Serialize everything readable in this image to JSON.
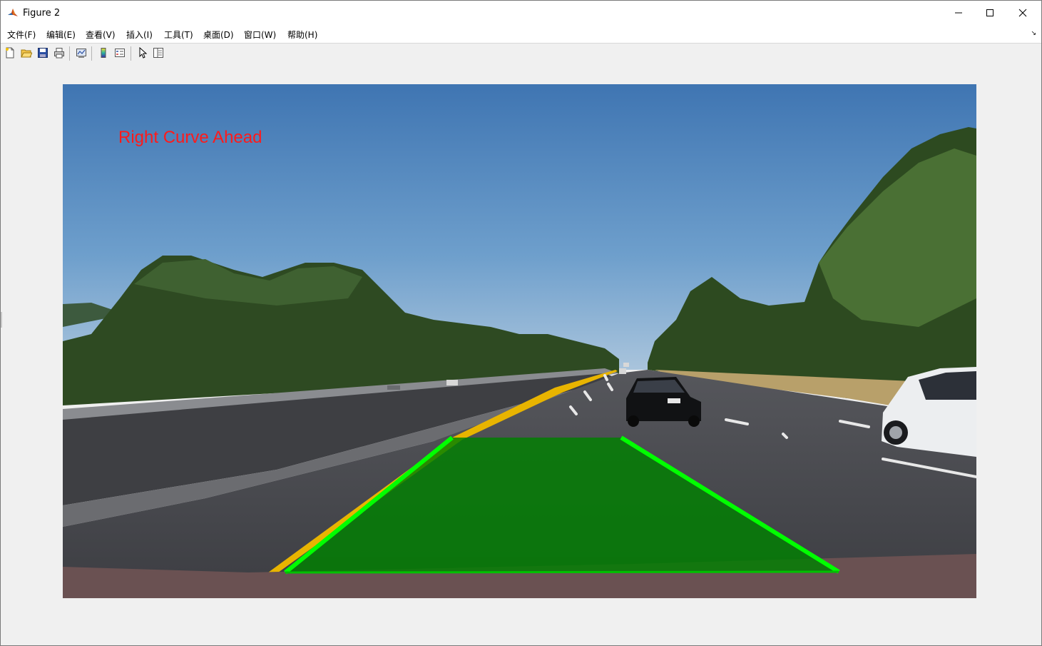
{
  "window": {
    "title": "Figure 2"
  },
  "menu": {
    "items": [
      "文件(F)",
      "编辑(E)",
      "查看(V)",
      "插入(I)",
      "工具(T)",
      "桌面(D)",
      "窗口(W)",
      "帮助(H)"
    ]
  },
  "toolbar": {
    "buttons": [
      "new-figure-icon",
      "open-file-icon",
      "save-icon",
      "print-icon",
      "link-plot-icon",
      "insert-colorbar-icon",
      "insert-legend-icon",
      "edit-plot-arrow-icon",
      "property-inspector-icon"
    ]
  },
  "figure": {
    "annotation": "Right Curve Ahead",
    "colors": {
      "annotation": "#ff1a1a",
      "lane_fill": "#008000",
      "lane_edge": "#00ff00",
      "yellow_line": "#e8b400"
    }
  }
}
